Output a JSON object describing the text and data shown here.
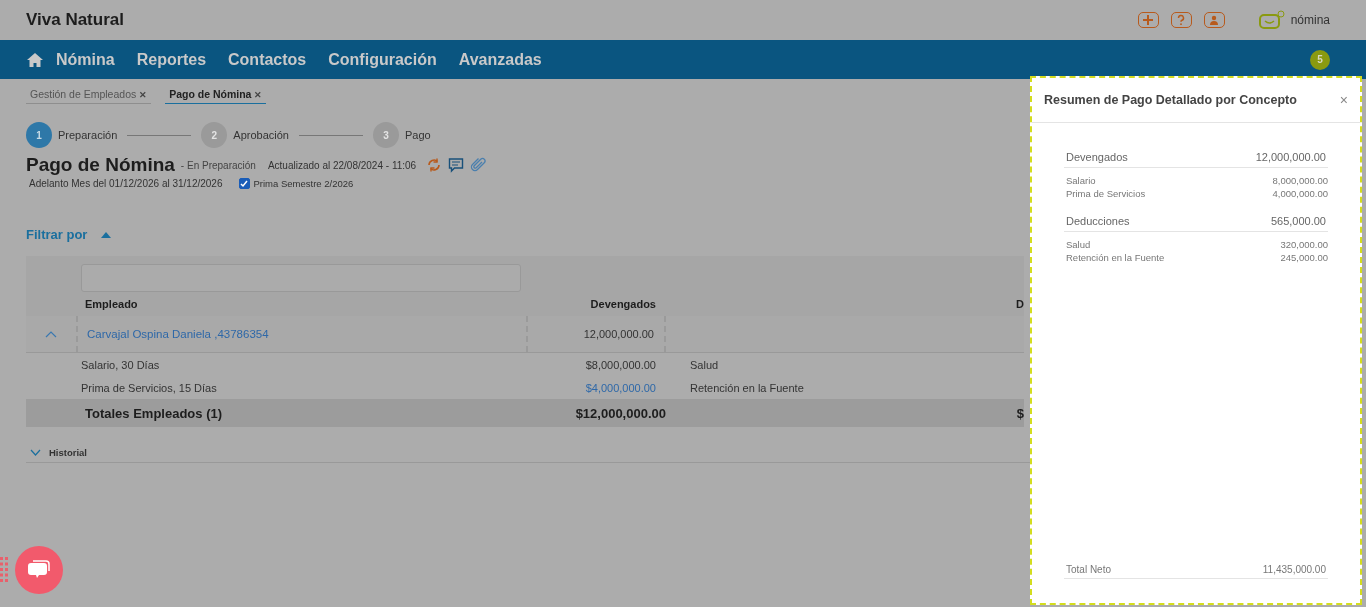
{
  "app": {
    "title": "Viva Natural",
    "brand": "nómina"
  },
  "nav": {
    "items": [
      "Nómina",
      "Reportes",
      "Contactos",
      "Configuración",
      "Avanzadas"
    ],
    "badge": "5"
  },
  "tabs": [
    {
      "label": "Gestión de Empleados",
      "close": "✕",
      "selected": false
    },
    {
      "label": "Pago de Nómina",
      "close": "✕",
      "selected": true
    }
  ],
  "stepper": [
    {
      "number": "1",
      "label": "Preparación",
      "selected": true
    },
    {
      "number": "2",
      "label": "Aprobación",
      "selected": false
    },
    {
      "number": "3",
      "label": "Pago",
      "selected": false
    }
  ],
  "page": {
    "title": "Pago de Nómina",
    "status": "- En Preparación",
    "updated": "Actualizado al 22/08/2024 - 11:06",
    "period": "Adelanto Mes del 01/12/2026 al 31/12/2026",
    "prima": {
      "label": "Prima Semestre 2/2026",
      "checked": true
    }
  },
  "filter": {
    "label": "Filtrar por",
    "expanded": true
  },
  "table": {
    "columns": [
      "Empleado",
      "Devengados",
      "D"
    ],
    "employee": {
      "name": "Carvajal Ospina Daniela ,43786354",
      "devengados": "12,000,000.00",
      "expanded": true
    },
    "details": [
      {
        "concept": "Salario, 30 Días",
        "amount": "$8,000,000.00",
        "highlighted": false,
        "deduction": "Salud"
      },
      {
        "concept": "Prima de Servicios, 15 Días",
        "amount": "$4,000,000.00",
        "highlighted": true,
        "deduction": "Retención en la Fuente"
      }
    ],
    "totals": {
      "label": "Totales Empleados (1)",
      "devengados": "$12,000,000.00",
      "deducciones": "$"
    }
  },
  "history": {
    "label": "Historial",
    "expanded": false
  },
  "panel": {
    "title": "Resumen de Pago Detallado por Concepto",
    "close": "×",
    "groups": [
      {
        "label": "Devengados",
        "total": "12,000,000.00",
        "items": [
          {
            "label": "Salario",
            "value": "8,000,000.00"
          },
          {
            "label": "Prima de Servicios",
            "value": "4,000,000.00"
          }
        ]
      },
      {
        "label": "Deducciones",
        "total": "565,000.00",
        "items": [
          {
            "label": "Salud",
            "value": "320,000.00"
          },
          {
            "label": "Retención en la Fuente",
            "value": "245,000.00"
          }
        ]
      }
    ],
    "net": {
      "label": "Total Neto",
      "value": "11,435,000.00"
    }
  }
}
